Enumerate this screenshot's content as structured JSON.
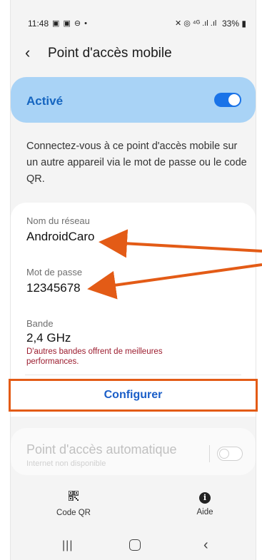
{
  "status_bar": {
    "time": "11:48",
    "left_icons": "▣ ▣ ⊖ •",
    "right_icons": "✕ ◎ ⁴ᴳ .ıl .ıl",
    "battery": "33%"
  },
  "header": {
    "title": "Point d'accès mobile"
  },
  "hotspot_toggle": {
    "label": "Activé",
    "state": "on"
  },
  "description": "Connectez-vous à ce point d'accès mobile sur un autre appareil via le mot de passe ou le code QR.",
  "network": {
    "name_label": "Nom du réseau",
    "name_value": "AndroidCaro",
    "password_label": "Mot de passe",
    "password_value": "12345678",
    "band_label": "Bande",
    "band_value": "2,4 GHz",
    "band_note": "D'autres bandes offrent de meilleures performances."
  },
  "configure_button": "Configurer",
  "auto_hotspot": {
    "title": "Point d'accès automatique",
    "subtitle": "Internet non disponible",
    "state": "off"
  },
  "bottom_actions": {
    "qr_label": "Code QR",
    "help_label": "Aide"
  },
  "colors": {
    "accent_blue": "#1a73e8",
    "toggle_card": "#a9d3f6",
    "annotation_orange": "#e35b16",
    "warning_red": "#9c1c2e"
  }
}
